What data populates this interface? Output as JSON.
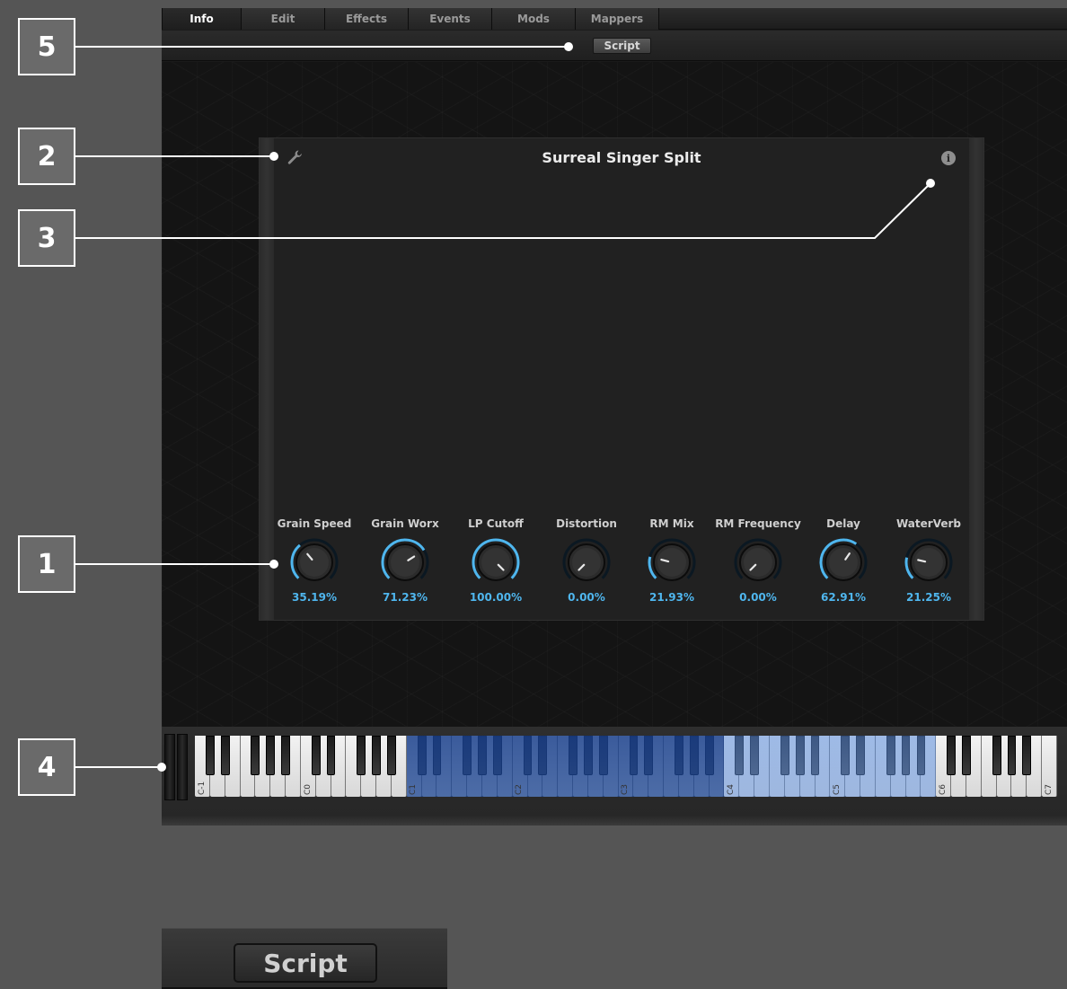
{
  "tabs": [
    {
      "label": "Info",
      "active": true
    },
    {
      "label": "Edit",
      "active": false
    },
    {
      "label": "Effects",
      "active": false
    },
    {
      "label": "Events",
      "active": false
    },
    {
      "label": "Mods",
      "active": false
    },
    {
      "label": "Mappers",
      "active": false
    }
  ],
  "subbar": {
    "script_label": "Script"
  },
  "panel": {
    "title": "Surreal Singer Split",
    "settings_icon": "wrench-icon",
    "info_icon": "info-icon",
    "info_glyph": "i"
  },
  "knobs": [
    {
      "label": "Grain Speed",
      "value": "35.19%",
      "level": 0.3519
    },
    {
      "label": "Grain Worx",
      "value": "71.23%",
      "level": 0.7123
    },
    {
      "label": "LP Cutoff",
      "value": "100.00%",
      "level": 1.0
    },
    {
      "label": "Distortion",
      "value": "0.00%",
      "level": 0.0
    },
    {
      "label": "RM Mix",
      "value": "21.93%",
      "level": 0.2193
    },
    {
      "label": "RM Frequency",
      "value": "0.00%",
      "level": 0.0
    },
    {
      "label": "Delay",
      "value": "62.91%",
      "level": 0.6291
    },
    {
      "label": "WaterVerb",
      "value": "21.25%",
      "level": 0.2125
    }
  ],
  "keyboard": {
    "octave_labels": [
      "C-1",
      "C0",
      "C1",
      "C2",
      "C3",
      "C4",
      "C5",
      "C6",
      "C7"
    ],
    "zones": {
      "dark_start": "C1",
      "dark_end": "C3",
      "light_start": "C4",
      "light_end": "C6"
    }
  },
  "callouts": [
    "5",
    "2",
    "3",
    "1",
    "4"
  ],
  "zoom": {
    "script_label": "Script"
  },
  "colors": {
    "accent": "#4fb6ee",
    "background": "#555555"
  }
}
